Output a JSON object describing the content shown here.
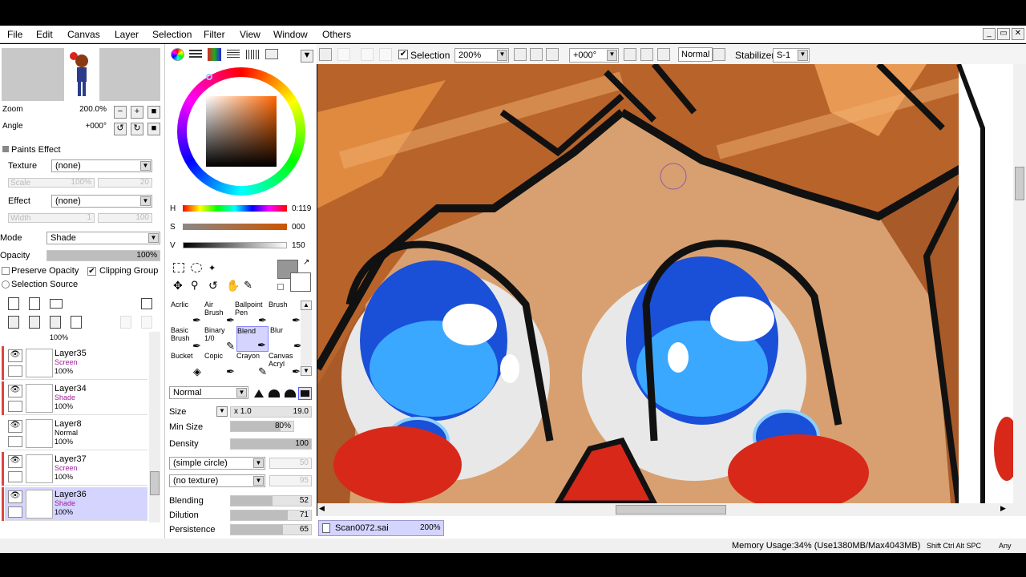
{
  "menu": [
    "File",
    "Edit",
    "Canvas",
    "Layer",
    "Selection",
    "Filter",
    "View",
    "Window",
    "Others"
  ],
  "navigator": {
    "zoom_label": "Zoom",
    "zoom_value": "200.0%",
    "angle_label": "Angle",
    "angle_value": "+000°"
  },
  "paints_effect": {
    "header": "Paints Effect",
    "texture_label": "Texture",
    "texture_value": "(none)",
    "scale_label": "Scale",
    "scale_value": "100%",
    "scale_num": "20",
    "effect_label": "Effect",
    "effect_value": "(none)",
    "width_label": "Width",
    "width_value": "1",
    "width_num": "100"
  },
  "layer_props": {
    "mode_label": "Mode",
    "mode_value": "Shade",
    "opacity_label": "Opacity",
    "opacity_value": "100%",
    "opacity": 1.0,
    "preserve_opacity": "Preserve Opacity",
    "clipping_group": "Clipping Group",
    "selection_source": "Selection Source"
  },
  "layers": {
    "top_partial_opacity": "100%",
    "items": [
      {
        "name": "Layer35",
        "mode": "Screen",
        "opacity": "100%"
      },
      {
        "name": "Layer34",
        "mode": "Shade",
        "opacity": "100%"
      },
      {
        "name": "Layer8",
        "mode": "Normal",
        "opacity": "100%"
      },
      {
        "name": "Layer37",
        "mode": "Screen",
        "opacity": "100%"
      },
      {
        "name": "Layer36",
        "mode": "Shade",
        "opacity": "100%"
      }
    ]
  },
  "color": {
    "h_label": "H",
    "h_value": "0:119",
    "s_label": "S",
    "s_value": "000",
    "v_label": "V",
    "v_value": "150"
  },
  "tools": [
    {
      "l1": "Acrlic",
      "l2": ""
    },
    {
      "l1": "Air",
      "l2": "Brush"
    },
    {
      "l1": "Ballpoint",
      "l2": "Pen"
    },
    {
      "l1": "Brush",
      "l2": ""
    },
    {
      "l1": "Basic",
      "l2": "Brush"
    },
    {
      "l1": "Binary",
      "l2": "1/0"
    },
    {
      "l1": "Blend",
      "l2": ""
    },
    {
      "l1": "Blur",
      "l2": ""
    },
    {
      "l1": "Bucket",
      "l2": ""
    },
    {
      "l1": "Copic",
      "l2": ""
    },
    {
      "l1": "Crayon",
      "l2": ""
    },
    {
      "l1": "Canvas",
      "l2": "Acryl"
    }
  ],
  "brush": {
    "blend_mode": "Normal",
    "size_label": "Size",
    "size_mult": "x 1.0",
    "size_value": "19.0",
    "min_size_label": "Min Size",
    "min_size_value": "80%",
    "min_size": 0.8,
    "density_label": "Density",
    "density_value": "100",
    "density": 1.0,
    "shape": "(simple circle)",
    "shape_num": "50",
    "texture": "(no texture)",
    "texture_num": "95",
    "blending_label": "Blending",
    "blending_value": "52",
    "blending": 0.52,
    "dilution_label": "Dilution",
    "dilution_value": "71",
    "dilution": 0.71,
    "persistence_label": "Persistence",
    "persistence_value": "65",
    "persistence": 0.65
  },
  "toolbar": {
    "selection_label": "Selection",
    "zoom_value": "200%",
    "angle_value": "+000°",
    "mode_value": "Normal",
    "stabilizer_label": "Stabilizer",
    "stabilizer_value": "S-1"
  },
  "document_tab": {
    "name": "Scan0072.sai",
    "zoom": "200%"
  },
  "status": {
    "memory": "Memory Usage:34% (Use1380MB/Max4043MB)",
    "keys": "Shift Ctrl Alt SPC",
    "any": "Any"
  }
}
